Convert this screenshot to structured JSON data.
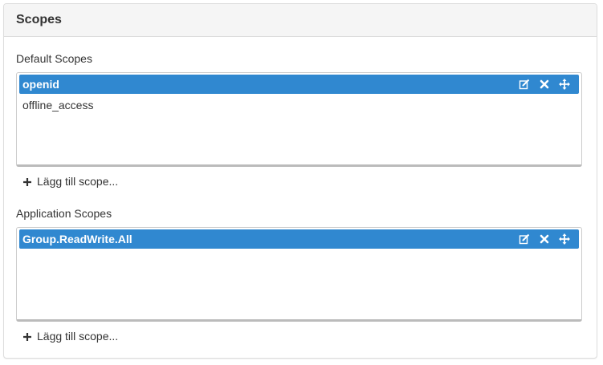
{
  "panel": {
    "title": "Scopes"
  },
  "default_scopes": {
    "label": "Default Scopes",
    "items": [
      {
        "name": "openid",
        "selected": true
      },
      {
        "name": "offline_access",
        "selected": false
      }
    ],
    "add_label": "Lägg till scope..."
  },
  "application_scopes": {
    "label": "Application Scopes",
    "items": [
      {
        "name": "Group.ReadWrite.All",
        "selected": true
      }
    ],
    "add_label": "Lägg till scope..."
  },
  "icons": {
    "edit": "edit-icon",
    "remove": "close-icon",
    "move": "move-icon",
    "add": "plus-icon"
  },
  "colors": {
    "selected_bg": "#3088d0",
    "heading_bg": "#f5f5f5"
  }
}
